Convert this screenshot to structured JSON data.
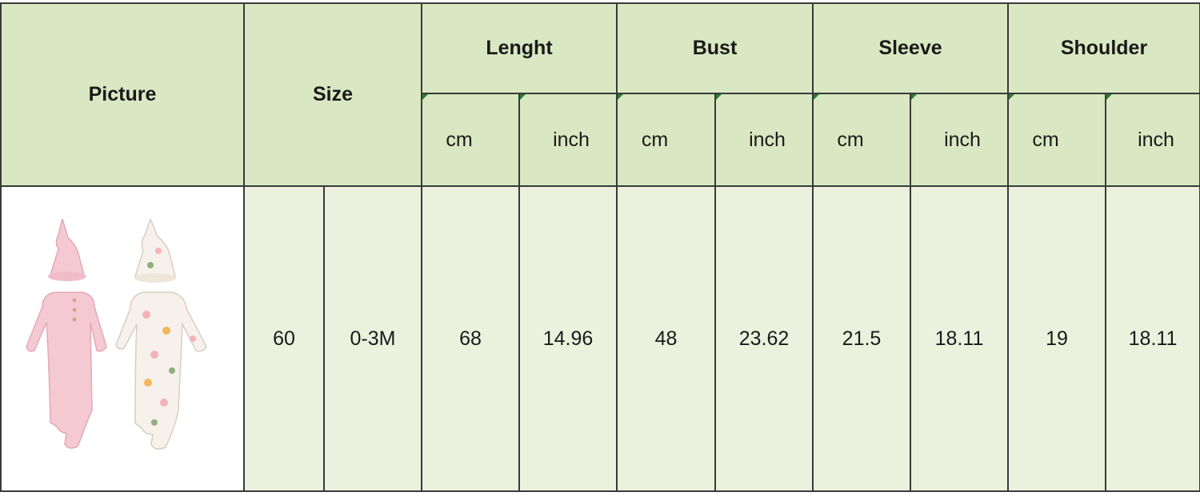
{
  "header": {
    "picture": "Picture",
    "size": "Size",
    "groups": [
      "Lenght",
      "Bust",
      "Sleeve",
      "Shoulder"
    ],
    "unit_cm": "cm",
    "unit_inch": "inch"
  },
  "image": {
    "description_icon": "baby-gowns-image",
    "colors": {
      "pink": "#f4c9d2",
      "floral_base": "#f6f1ea"
    }
  },
  "rows": [
    {
      "size_num": "60",
      "size_age": "0-3M",
      "length_cm": "68",
      "length_inch": "14.96",
      "bust_cm": "48",
      "bust_inch": "23.62",
      "sleeve_cm": "21.5",
      "sleeve_inch": "18.11",
      "shoulder_cm": "19",
      "shoulder_inch": "18.11"
    }
  ],
  "colors": {
    "header_bg": "#d9e8c2",
    "body_bg": "#ecf1de",
    "border": "#3a3a3a"
  }
}
